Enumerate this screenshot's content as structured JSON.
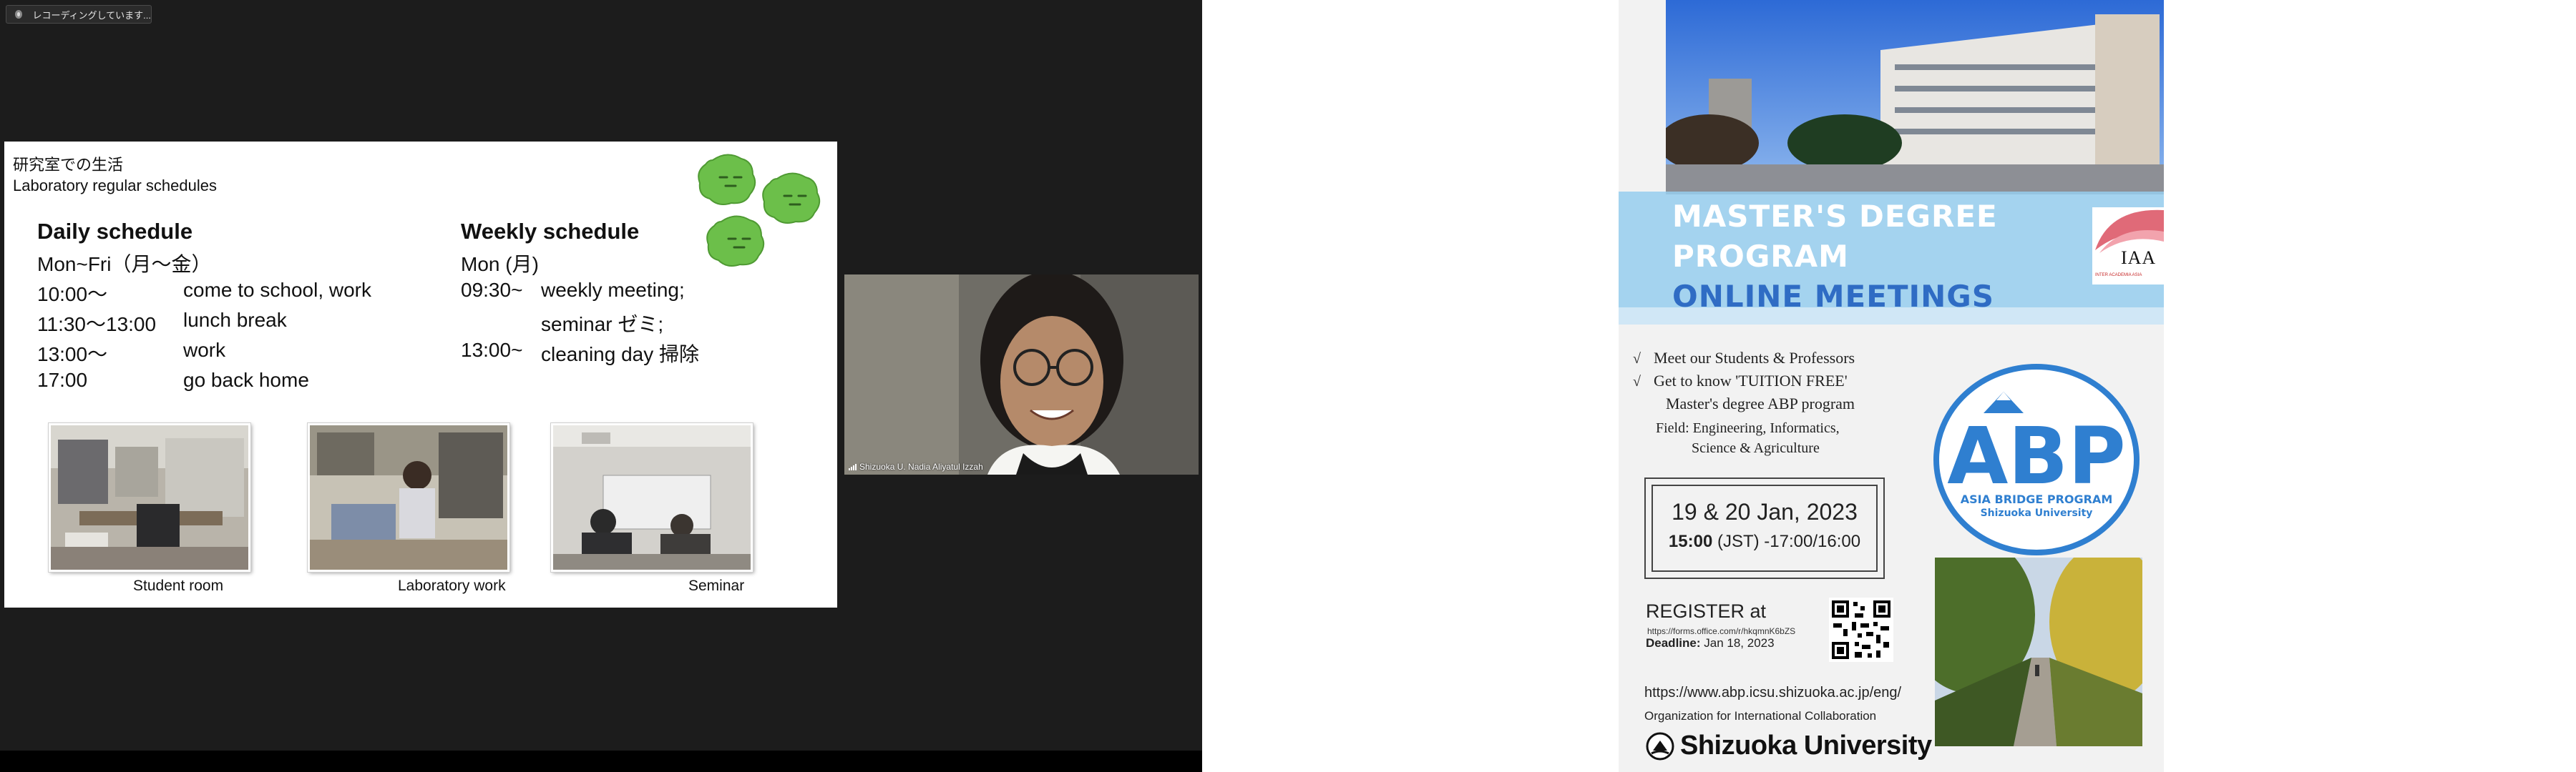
{
  "recording": {
    "label": "レコーディングしています..."
  },
  "slide": {
    "title_jp": "研究室での生活",
    "title_en": "Laboratory regular schedules",
    "daily": {
      "heading": "Daily schedule",
      "days": "Mon~Fri（月～金）",
      "rows": [
        {
          "time": "10:00～",
          "activity": "come to school, work"
        },
        {
          "time": "11:30～13:00",
          "activity": "lunch break"
        },
        {
          "time": "13:00～",
          "activity": "work"
        },
        {
          "time": "17:00",
          "activity": "go back home"
        }
      ]
    },
    "weekly": {
      "heading": "Weekly schedule",
      "day": "Mon (月)",
      "rows": [
        {
          "time": "09:30~",
          "activity": "weekly meeting;"
        },
        {
          "time": "",
          "activity": "seminar ゼミ;"
        },
        {
          "time": "13:00~",
          "activity": "cleaning day 掃除"
        }
      ]
    },
    "captions": [
      "Student room",
      "Laboratory work",
      "Seminar"
    ]
  },
  "video": {
    "participant_name": "Shizuoka U. Nadia Aliyatul Izzah"
  },
  "flyer": {
    "banner": [
      "MASTER'S DEGREE",
      "PROGRAM",
      "ONLINE MEETINGS"
    ],
    "iaa_logo": "IAA",
    "iaa_sub": "INTER ACADEMIA ASIA",
    "info": [
      "Meet our  Students  & Professors",
      "Get to know 'TUITION FREE'",
      "Master's degree ABP program",
      "Field: Engineering, Informatics,",
      "Science & Agriculture"
    ],
    "check_mark": "√",
    "abp": {
      "letters": "ABP",
      "name": "ASIA BRIDGE PROGRAM",
      "univ": "Shizuoka University"
    },
    "date_main": "19 & 20 Jan, 2023",
    "date_time_bold": "15:00",
    "date_time_rest": " (JST) -17:00/16:00",
    "register_title": "REGISTER at",
    "register_url": "https://forms.office.com/r/hkqmnK6bZS",
    "deadline_label": "Deadline:",
    "deadline_value": " Jan 18, 2023",
    "website": "https://www.abp.icsu.shizuoka.ac.jp/eng/",
    "org": "Organization for International Collaboration",
    "university": "Shizuoka University"
  },
  "colors": {
    "meeting_bg": "#1c1c1c",
    "banner_bg": "#96ceee",
    "banner_online": "#2f6cc4",
    "abp_blue": "#2f7fd0",
    "slime_green": "#6cbf4a"
  }
}
